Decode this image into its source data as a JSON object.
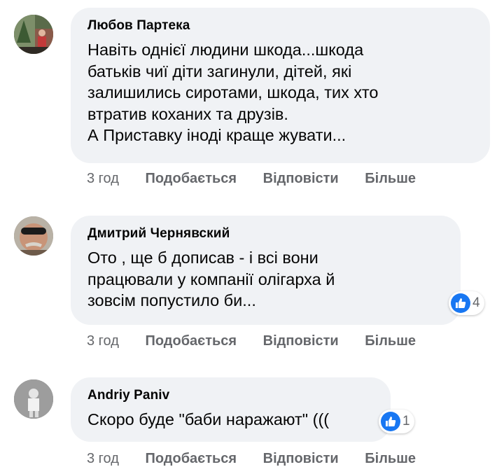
{
  "comments": [
    {
      "author": "Любов Партека",
      "text": "Навіть однієї людини шкода...шкода\nбатьків чиї діти загинули, дітей, які\nзалишились сиротами, шкода, тих хто\nвтратив коханих та друзів.\nА Приставку іноді краще жувати...",
      "time": "3 год",
      "like_label": "Подобається",
      "reply_label": "Відповісти",
      "more_label": "Більше",
      "reaction_icon": "like-icon"
    },
    {
      "author": "Дмитрий Чернявский",
      "text": "Ото , ще б дописав - і всі вони\nпрацювали у компанії олігарха й\nзовсім попустило би...",
      "time": "3 год",
      "like_label": "Подобається",
      "reply_label": "Відповісти",
      "more_label": "Більше",
      "reaction_icon": "like-icon",
      "reaction_count": "4"
    },
    {
      "author": "Andriy Paniv",
      "text": "Скоро буде \"баби наражают\" (((",
      "time": "3 год",
      "like_label": "Подобається",
      "reply_label": "Відповісти",
      "more_label": "Більше",
      "reaction_icon": "like-icon",
      "reaction_count": "1"
    }
  ],
  "colors": {
    "bubble": "#f0f2f5",
    "meta_text": "#65676b",
    "like_blue": "#1877f2"
  }
}
